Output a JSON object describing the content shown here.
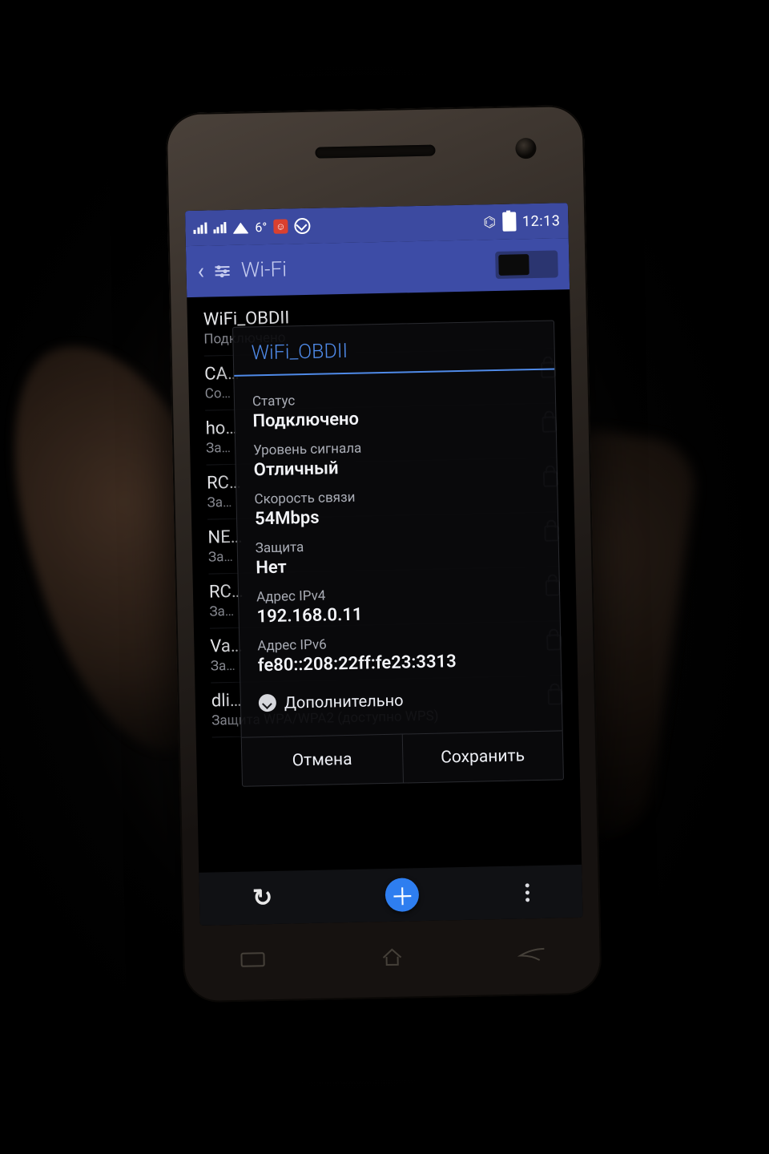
{
  "status_bar": {
    "temperature": "6°",
    "time": "12:13"
  },
  "app_bar": {
    "title": "Wi-Fi",
    "toggle_on": true
  },
  "wifi_list": [
    {
      "ssid": "WiFi_OBDII",
      "subtitle": "Подключено",
      "secured": false
    },
    {
      "ssid": "CA…",
      "subtitle": "Co…",
      "secured": true
    },
    {
      "ssid": "ho…",
      "subtitle": "За…",
      "secured": true
    },
    {
      "ssid": "RC…",
      "subtitle": "За…",
      "secured": true
    },
    {
      "ssid": "NE…",
      "subtitle": "За…",
      "secured": true
    },
    {
      "ssid": "RC…",
      "subtitle": "За…",
      "secured": true
    },
    {
      "ssid": "Va…",
      "subtitle": "За…",
      "secured": true
    },
    {
      "ssid": "dli…",
      "subtitle": "Защита WPA/WPA2 (доступно WPS)",
      "secured": true
    }
  ],
  "dialog": {
    "title": "WiFi_OBDII",
    "fields": {
      "status": {
        "label": "Статус",
        "value": "Подключено"
      },
      "signal": {
        "label": "Уровень сигнала",
        "value": "Отличный"
      },
      "link_speed": {
        "label": "Скорость связи",
        "value": "54Mbps"
      },
      "security": {
        "label": "Защита",
        "value": "Нет"
      },
      "ipv4": {
        "label": "Адрес IPv4",
        "value": "192.168.0.11"
      },
      "ipv6": {
        "label": "Адрес IPv6",
        "value": "fe80::208:22ff:fe23:3313"
      }
    },
    "advanced_label": "Дополнительно",
    "cancel_label": "Отмена",
    "save_label": "Сохранить"
  }
}
